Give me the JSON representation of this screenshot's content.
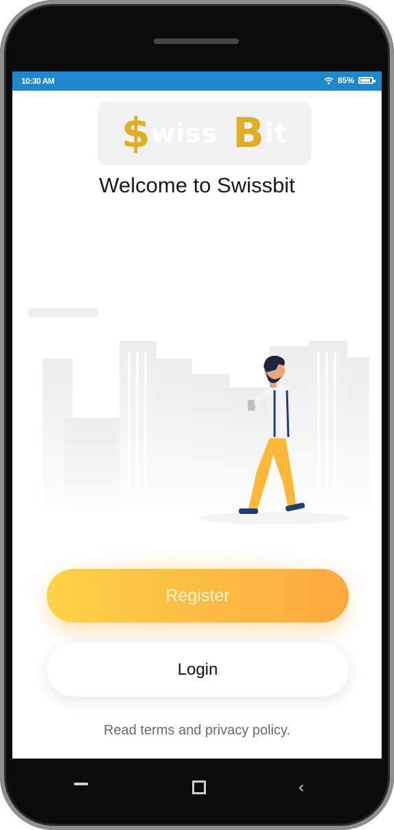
{
  "status_bar": {
    "time": "10:30 AM",
    "battery": "85%",
    "battery_level": 0.85,
    "background": "#1e88cf"
  },
  "logo": {
    "letter1": "$",
    "part1": "wiss",
    "letter2": "B",
    "part2": "it",
    "accent": "#e0ae22"
  },
  "welcome": "Welcome to Swissbit",
  "buttons": {
    "register": "Register",
    "login": "Login"
  },
  "terms": "Read terms and privacy policy.",
  "nav": {
    "recent_icon": "recent-apps-icon",
    "home_icon": "home-square-icon",
    "back_icon": "back-chevron-icon",
    "back_glyph": "‹"
  },
  "colors": {
    "register_start": "#fdd249",
    "register_end": "#fca83d",
    "shirt": "#f3f3f7",
    "pants": "#fdb83a",
    "shoes": "#1f3d7a"
  }
}
